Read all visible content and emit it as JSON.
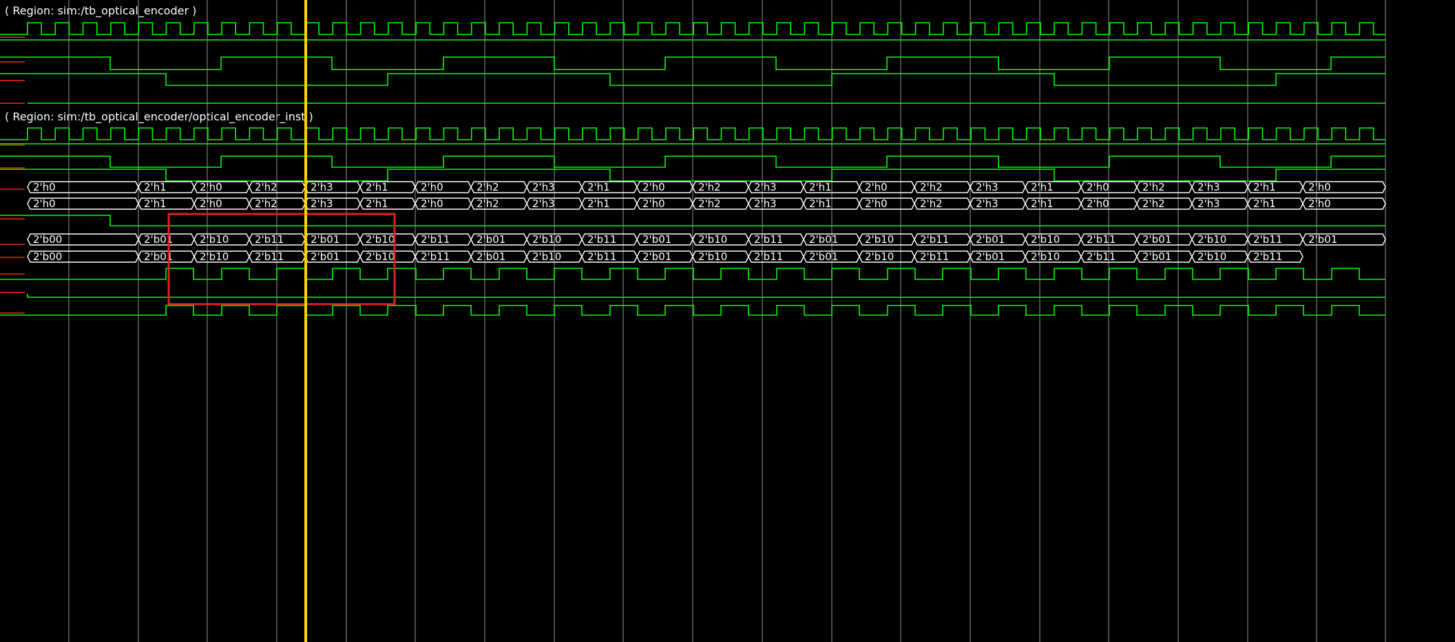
{
  "regions": [
    {
      "label": "( Region: sim:/tb_optical_encoder )"
    },
    {
      "label": "( Region: sim:/tb_optical_encoder/optical_encoder_inst )"
    }
  ],
  "colors": {
    "background": "#000000",
    "signal": "#00ff00",
    "bus_border": "#ffffff",
    "bus_text": "#ffffff",
    "grid": "#7f7f7f",
    "cursor": "#ffd200",
    "marker": "#ff2020",
    "highlight_box": "#e02020"
  },
  "cursor": {
    "description": "time cursor"
  },
  "selection_box": {
    "description": "highlighted region"
  },
  "buses": {
    "bus_a_values": [
      "2'h0",
      "2'h1",
      "2'h0",
      "2'h2",
      "2'h3",
      "2'h1",
      "2'h0",
      "2'h2",
      "2'h3",
      "2'h1",
      "2'h0",
      "2'h2",
      "2'h3",
      "2'h1",
      "2'h0",
      "2'h2",
      "2'h3",
      "2'h1",
      "2'h0",
      "2'h2",
      "2'h3",
      "2'h1",
      "2'h0"
    ],
    "bus_b_values": [
      "2'h0",
      "2'h1",
      "2'h0",
      "2'h2",
      "2'h3",
      "2'h1",
      "2'h0",
      "2'h2",
      "2'h3",
      "2'h1",
      "2'h0",
      "2'h2",
      "2'h3",
      "2'h1",
      "2'h0",
      "2'h2",
      "2'h3",
      "2'h1",
      "2'h0",
      "2'h2",
      "2'h3",
      "2'h1",
      "2'h0"
    ],
    "bus_c_values": [
      "2'b00",
      "2'b01",
      "2'b10",
      "2'b11",
      "2'b01",
      "2'b10",
      "2'b11",
      "2'b01",
      "2'b10",
      "2'b11",
      "2'b01",
      "2'b10",
      "2'b11",
      "2'b01",
      "2'b10",
      "2'b11",
      "2'b01",
      "2'b10",
      "2'b11",
      "2'b01",
      "2'b10",
      "2'b11",
      "2'b01"
    ],
    "bus_d_values": [
      "2'b00",
      "2'b01",
      "2'b10",
      "2'b11",
      "2'b01",
      "2'b10",
      "2'b11",
      "2'b01",
      "2'b10",
      "2'b11",
      "2'b01",
      "2'b10",
      "2'b11",
      "2'b01",
      "2'b10",
      "2'b11",
      "2'b01",
      "2'b10",
      "2'b11",
      "2'b01",
      "2'b10",
      "2'b11"
    ]
  }
}
